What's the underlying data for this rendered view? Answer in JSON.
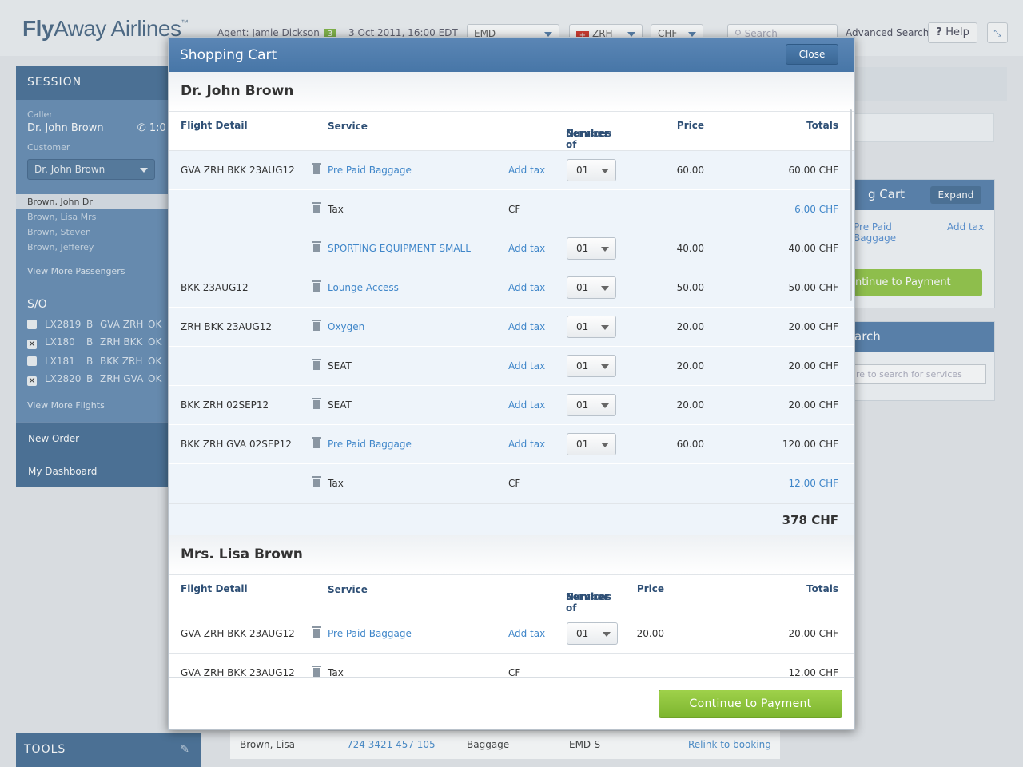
{
  "app": {
    "logo_fly": "Fly",
    "logo_rest": "Away Airlines",
    "logo_tm": "™",
    "agent": "Agent: Jamie Dickson",
    "agent_badge": "3",
    "datetime": "3 Oct 2011, 16:00 EDT",
    "emd_select": "EMD",
    "city_select": "ZRH",
    "currency_select": "CHF",
    "search_placeholder": "Search",
    "advanced_search": "Advanced Search",
    "help": "Help"
  },
  "sidebar": {
    "session_title": "SESSION",
    "caller_label": "Caller",
    "caller_name": "Dr. John Brown",
    "caller_time": "1:0",
    "customer_label": "Customer",
    "customer_select": "Dr. John Brown",
    "passengers": [
      "Brown, John Dr",
      "Brown, Lisa Mrs",
      "Brown, Steven",
      "Brown, Jefferey"
    ],
    "view_more_passengers": "View More Passengers",
    "so_title": "S/O",
    "segments": [
      {
        "flight": "LX2819",
        "cls": "B",
        "route": "GVA ZRH",
        "status": "OK",
        "checked": ""
      },
      {
        "flight": "LX180",
        "cls": "B",
        "route": "ZRH BKK",
        "status": "OK",
        "checked": "✕"
      },
      {
        "flight": "LX181",
        "cls": "B",
        "route": "BKK ZRH",
        "status": "OK",
        "checked": ""
      },
      {
        "flight": "LX2820",
        "cls": "B",
        "route": "ZRH GVA",
        "status": "OK",
        "checked": "✕"
      }
    ],
    "view_more_flights": "View More Flights",
    "new_order": "New Order",
    "my_dashboard": "My Dashboard",
    "tools": "TOOLS"
  },
  "right_panels": {
    "cart_title": "g Cart",
    "expand": "Expand",
    "item_line1": "Pre Paid",
    "item_line2": "Baggage",
    "add_tax": "Add tax",
    "continue": "ntinue to Payment",
    "search_title": "arch",
    "search_placeholder": "re to search for services"
  },
  "bg_row": {
    "name": "Brown, Lisa",
    "ticket": "724 3421 457 105",
    "type": "Baggage",
    "doc": "EMD-S",
    "action": "Relink to booking"
  },
  "modal": {
    "title": "Shopping Cart",
    "close": "Close",
    "continue_to_payment": "Continue to Payment",
    "columns": {
      "flight_detail": "Flight Detail",
      "service": "Service",
      "num_services_1": "Number of",
      "num_services_2": "Services",
      "price": "Price",
      "totals": "Totals"
    },
    "passengers": [
      {
        "name": "Dr. John Brown",
        "subtotal": "378 CHF",
        "rows": [
          {
            "flight": "GVA ZRH BKK 23AUG12",
            "service": "Pre Paid Baggage",
            "link": true,
            "action": "Add tax",
            "qty": "01",
            "price": "60.00",
            "total": "60.00 CHF",
            "total_link": false
          },
          {
            "flight": "",
            "service": "Tax",
            "link": false,
            "action": "CF",
            "qty": "",
            "price": "",
            "total": "6.00 CHF",
            "total_link": true
          },
          {
            "flight": "",
            "service": "SPORTING EQUIPMENT SMALL",
            "link": true,
            "action": "Add tax",
            "qty": "01",
            "price": "40.00",
            "total": "40.00 CHF",
            "total_link": false
          },
          {
            "flight": "BKK 23AUG12",
            "service": "Lounge Access",
            "link": true,
            "action": "Add tax",
            "qty": "01",
            "price": "50.00",
            "total": "50.00 CHF",
            "total_link": false
          },
          {
            "flight": "ZRH BKK 23AUG12",
            "service": "Oxygen",
            "link": true,
            "action": "Add tax",
            "qty": "01",
            "price": "20.00",
            "total": "20.00 CHF",
            "total_link": false
          },
          {
            "flight": "",
            "service": "SEAT",
            "link": false,
            "action": "Add tax",
            "qty": "01",
            "price": "20.00",
            "total": "20.00 CHF",
            "total_link": false
          },
          {
            "flight": "BKK ZRH 02SEP12",
            "service": "SEAT",
            "link": false,
            "action": "Add tax",
            "qty": "01",
            "price": "20.00",
            "total": "20.00 CHF",
            "total_link": false
          },
          {
            "flight": "BKK ZRH GVA 02SEP12",
            "service": "Pre Paid Baggage",
            "link": true,
            "action": "Add tax",
            "qty": "01",
            "price": "60.00",
            "total": "120.00 CHF",
            "total_link": false
          },
          {
            "flight": "",
            "service": "Tax",
            "link": false,
            "action": "CF",
            "qty": "",
            "price": "",
            "total": "12.00 CHF",
            "total_link": true
          }
        ]
      },
      {
        "name": "Mrs. Lisa Brown",
        "rows": [
          {
            "flight": "GVA ZRH BKK 23AUG12",
            "service": "Pre Paid Baggage",
            "link": true,
            "action": "Add tax",
            "qty": "01",
            "price": "20.00",
            "total": "20.00 CHF",
            "total_link": false
          },
          {
            "flight": "GVA ZRH BKK 23AUG12",
            "service": "Tax",
            "link": false,
            "action": "CF",
            "qty": "",
            "price": "",
            "total": "12.00 CHF",
            "total_link": false
          }
        ]
      }
    ]
  }
}
